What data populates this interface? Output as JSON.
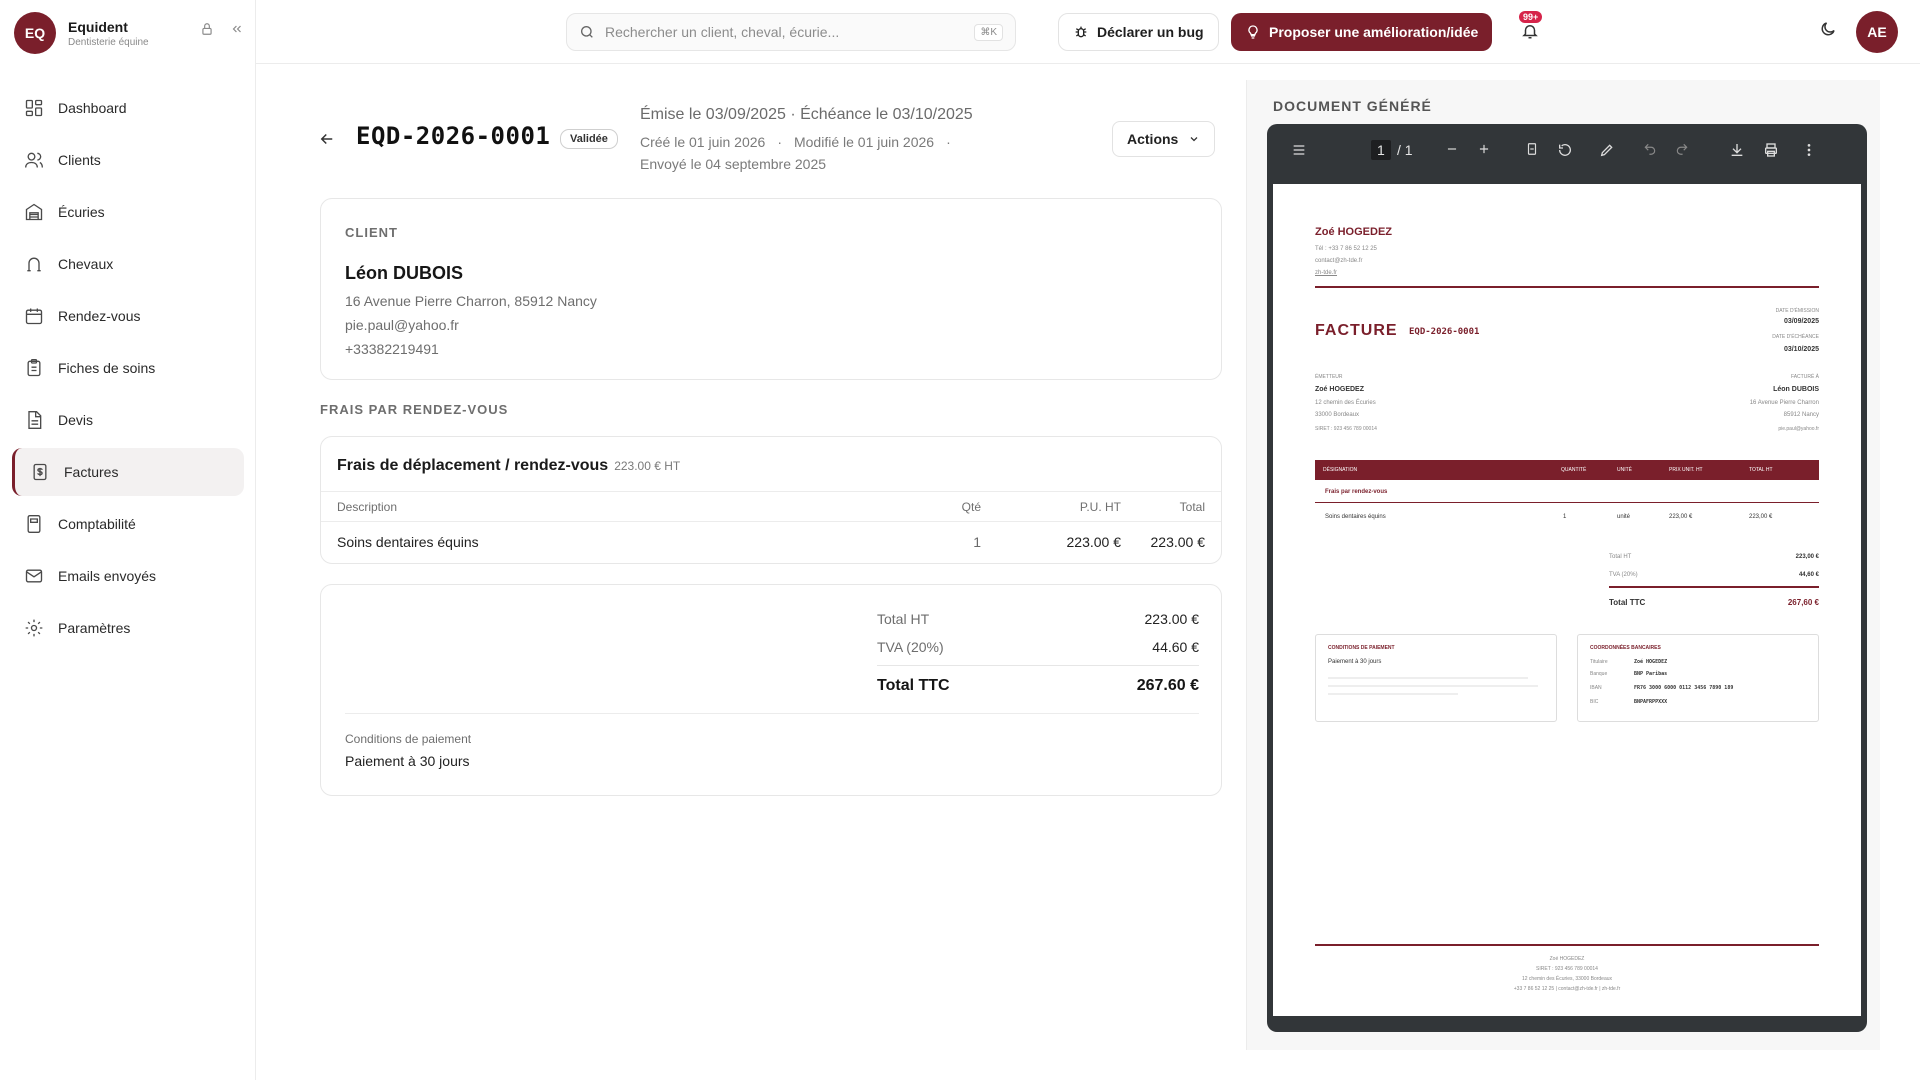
{
  "brand": {
    "logo": "EQ",
    "name": "Equident",
    "subtitle": "Dentisterie équine"
  },
  "nav": [
    {
      "label": "Dashboard",
      "icon": "dashboard-icon"
    },
    {
      "label": "Clients",
      "icon": "users-icon"
    },
    {
      "label": "Écuries",
      "icon": "stable-icon"
    },
    {
      "label": "Chevaux",
      "icon": "horseshoe-icon"
    },
    {
      "label": "Rendez-vous",
      "icon": "calendar-icon"
    },
    {
      "label": "Fiches de soins",
      "icon": "clipboard-icon"
    },
    {
      "label": "Devis",
      "icon": "document-icon"
    },
    {
      "label": "Factures",
      "icon": "invoice-icon",
      "active": true
    },
    {
      "label": "Comptabilité",
      "icon": "calculator-icon"
    },
    {
      "label": "Emails envoyés",
      "icon": "mail-icon"
    },
    {
      "label": "Paramètres",
      "icon": "gear-icon"
    }
  ],
  "header": {
    "search_placeholder": "Rechercher un client, cheval, écurie...",
    "search_shortcut": "⌘K",
    "bug_button": "Déclarer un bug",
    "idea_button": "Proposer une amélioration/idée",
    "notif_count": "99+",
    "user_initials": "AE"
  },
  "invoice": {
    "number": "EQD-2026-0001",
    "status": "Validée",
    "dates_main": "Émise le 03/09/2025 · Échéance le 03/10/2025",
    "created": "Créé le 01 juin 2026",
    "modified": "Modifié le 01 juin 2026",
    "sent": "Envoyé le 04 septembre 2025",
    "actions_label": "Actions"
  },
  "client": {
    "section_label": "CLIENT",
    "name": "Léon DUBOIS",
    "address": "16 Avenue Pierre Charron, 85912 Nancy",
    "email": "pie.paul@yahoo.fr",
    "phone": "+33382219491"
  },
  "fees": {
    "section_label": "FRAIS PAR RENDEZ-VOUS",
    "title": "Frais de déplacement / rendez-vous",
    "price": "223.00 € HT",
    "columns": [
      "Description",
      "Qté",
      "P.U. HT",
      "Total"
    ],
    "rows": [
      {
        "description": "Soins dentaires équins",
        "qty": "1",
        "unit": "223.00 €",
        "total": "223.00 €"
      }
    ]
  },
  "totals": {
    "ht_label": "Total HT",
    "ht_value": "223.00 €",
    "tva_label": "TVA (20%)",
    "tva_value": "44.60 €",
    "ttc_label": "Total TTC",
    "ttc_value": "267.60 €",
    "conditions_label": "Conditions de paiement",
    "conditions_value": "Paiement à 30 jours"
  },
  "document": {
    "section_label": "DOCUMENT GÉNÉRÉ",
    "page_current": "1",
    "page_total": "/ 1",
    "pdf": {
      "emitter_name": "Zoé HOGEDEZ",
      "emitter_tel": "Tél : +33 7 86 52 12 25",
      "emitter_email": "contact@zh-tde.fr",
      "emitter_site": "zh-tde.fr",
      "title": "FACTURE",
      "number": "EQD-2026-0001",
      "issue_label": "DATE D'ÉMISSION",
      "issue_date": "03/09/2025",
      "due_label": "DATE D'ÉCHÉANCE",
      "due_date": "03/10/2025",
      "emitter_label": "ÉMETTEUR",
      "emitter_addr1": "12 chemin des Écuries",
      "emitter_addr2": "33000 Bordeaux",
      "emitter_siret": "SIRET : 923 456 789 00014",
      "billed_label": "FACTURÉ À",
      "billed_name": "Léon DUBOIS",
      "billed_addr1": "16 Avenue Pierre Charron",
      "billed_addr2": "85912 Nancy",
      "billed_email": "pie.paul@yahoo.fr",
      "table_headers": [
        "DÉSIGNATION",
        "QUANTITÉ",
        "UNITÉ",
        "PRIX UNIT. HT",
        "TOTAL HT"
      ],
      "group_label": "Frais par rendez-vous",
      "row": [
        "Soins dentaires équins",
        "1",
        "unité",
        "223,00 €",
        "223,00 €"
      ],
      "total_ht_label": "Total HT",
      "total_ht": "223,00 €",
      "tva_label": "TVA (20%)",
      "tva": "44,60 €",
      "total_ttc_label": "Total TTC",
      "total_ttc": "267,60 €",
      "conditions_title": "CONDITIONS DE PAIEMENT",
      "conditions_text": "Paiement à 30 jours",
      "bank_title": "COORDONNÉES BANCAIRES",
      "bank_holder_label": "Titulaire",
      "bank_holder": "Zoé HOGEDEZ",
      "bank_name_label": "Banque",
      "bank_name": "BNP Paribas",
      "iban_label": "IBAN",
      "iban": "FR76 3000 6000 0112 3456 7890 189",
      "bic_label": "BIC",
      "bic": "BNPAFRPPXXX",
      "footer_name": "Zoé HOGEDEZ",
      "footer_siret": "SIRET : 923 456 789 00014",
      "footer_addr": "12 chemin des Écuries, 33000 Bordeaux",
      "footer_contact": "+33 7 86 52 12 25 | contact@zh-tde.fr | zh-tde.fr"
    }
  },
  "colors": {
    "brand": "#7a1f2b",
    "badge": "#d6244a"
  }
}
